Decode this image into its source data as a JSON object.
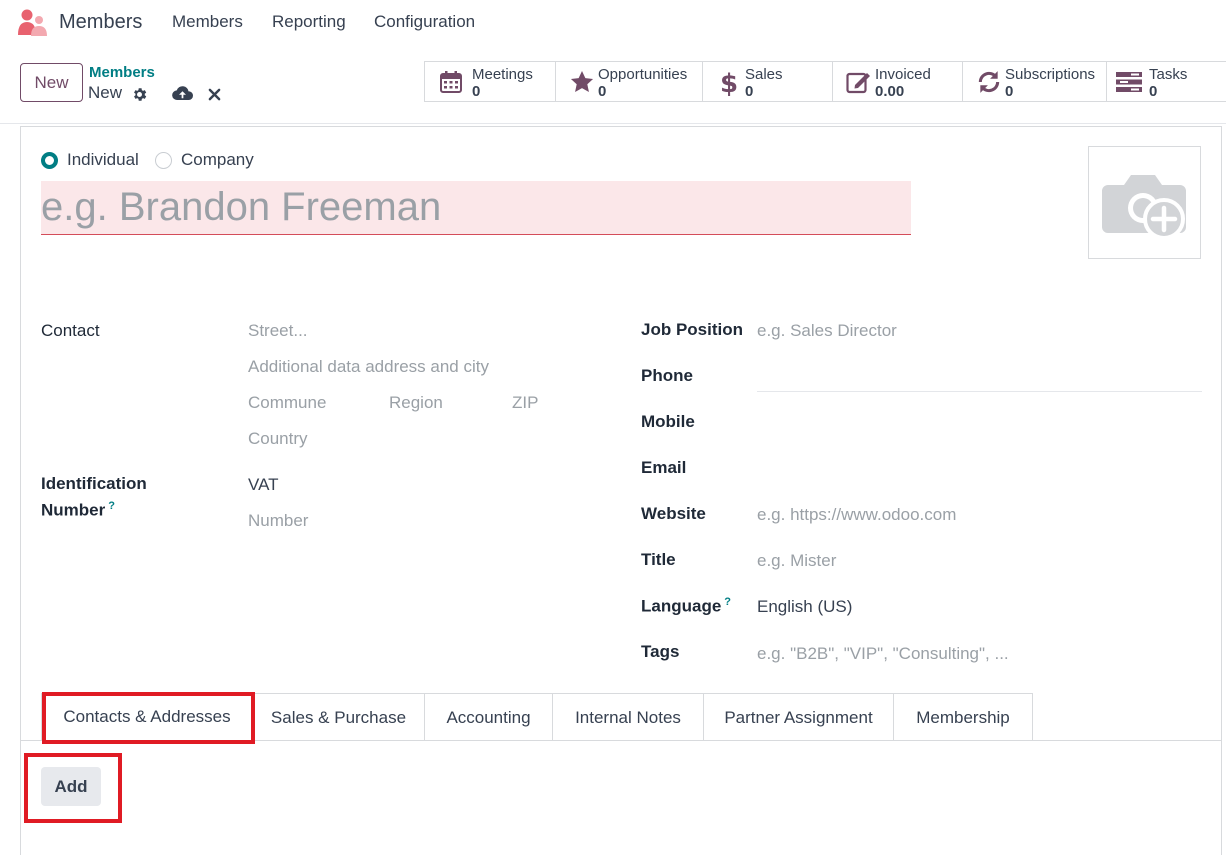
{
  "navbar": {
    "app_name": "Members",
    "menus": [
      "Members",
      "Reporting",
      "Configuration"
    ]
  },
  "control_panel": {
    "new_label": "New",
    "breadcrumb_parent": "Members",
    "breadcrumb_current": "New"
  },
  "smart_buttons": [
    {
      "title": "Meetings",
      "value": "0",
      "icon": "calendar-icon"
    },
    {
      "title": "Opportunities",
      "value": "0",
      "icon": "star-icon"
    },
    {
      "title": "Sales",
      "value": "0",
      "icon": "dollar-icon"
    },
    {
      "title": "Invoiced",
      "value": "0.00",
      "icon": "edit-invoice-icon"
    },
    {
      "title": "Subscriptions",
      "value": "0",
      "icon": "refresh-icon"
    },
    {
      "title": "Tasks",
      "value": "0",
      "icon": "tasks-icon"
    }
  ],
  "form": {
    "type_individual": "Individual",
    "type_company": "Company",
    "name_placeholder": "e.g. Brandon Freeman",
    "contact_label": "Contact",
    "street_placeholder": "Street...",
    "street2_placeholder": "Additional data address and city",
    "commune_placeholder": "Commune",
    "region_placeholder": "Region",
    "zip_placeholder": "ZIP",
    "country_placeholder": "Country",
    "identification_label_1": "Identification",
    "identification_label_2": "Number",
    "vat_value": "VAT",
    "number_placeholder": "Number",
    "job_position_label": "Job Position",
    "job_position_placeholder": "e.g. Sales Director",
    "phone_label": "Phone",
    "mobile_label": "Mobile",
    "email_label": "Email",
    "website_label": "Website",
    "website_placeholder": "e.g. https://www.odoo.com",
    "title_label": "Title",
    "title_placeholder": "e.g. Mister",
    "language_label": "Language",
    "language_value": "English (US)",
    "tags_label": "Tags",
    "tags_placeholder": "e.g. \"B2B\", \"VIP\", \"Consulting\", ...",
    "help_mark": "?"
  },
  "tabs": [
    "Contacts & Addresses",
    "Sales & Purchase",
    "Accounting",
    "Internal Notes",
    "Partner Assignment",
    "Membership"
  ],
  "add_label": "Add",
  "colors": {
    "brand": "#714B67",
    "accent": "#017e84",
    "required_bg": "#fbe7e9",
    "highlight": "#e01b24"
  }
}
